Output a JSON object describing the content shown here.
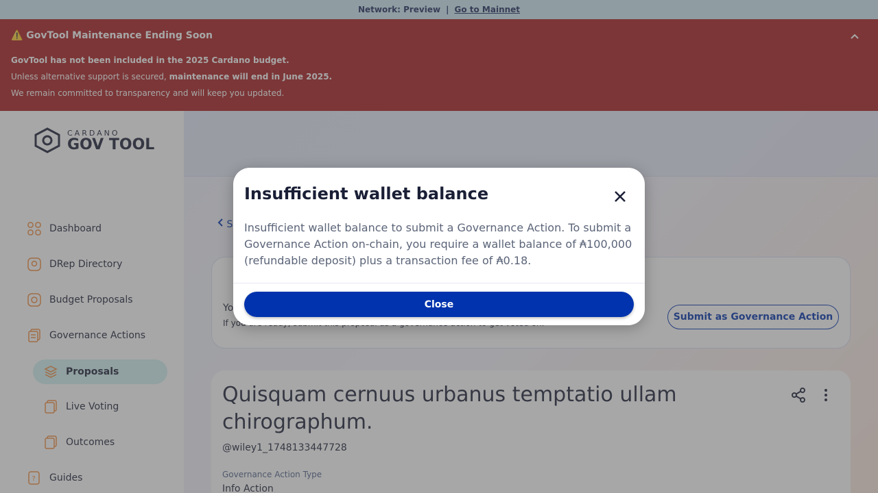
{
  "network_bar": {
    "label": "Network: Preview",
    "separator": "|",
    "link": "Go to Mainnet"
  },
  "banner": {
    "title": "⚠️ GovTool Maintenance Ending Soon",
    "line1": "GovTool has not been included in the 2025 Cardano budget.",
    "line2_prefix": "Unless alternative support is secured,",
    "line2_bold": "maintenance will end in June 2025.",
    "line3": "We remain committed to transparency and will keep you updated."
  },
  "logo": {
    "small": "CARDANO",
    "big": "GOV TOOL"
  },
  "sidebar": {
    "items": [
      {
        "label": "Dashboard",
        "icon": "dashboard-icon"
      },
      {
        "label": "DRep Directory",
        "icon": "drep-icon"
      },
      {
        "label": "Budget Proposals",
        "icon": "budget-icon"
      },
      {
        "label": "Governance Actions",
        "icon": "document-icon"
      },
      {
        "label": "Proposals",
        "icon": "layers-icon"
      },
      {
        "label": "Live Voting",
        "icon": "document-icon"
      },
      {
        "label": "Outcomes",
        "icon": "document-icon"
      },
      {
        "label": "Guides",
        "icon": "guide-icon"
      }
    ]
  },
  "main": {
    "back_label": "S",
    "card1": {
      "title_fragment": "Yo",
      "subtitle": "If you are ready, submit this proposal as a governance action to get voted on.",
      "submit_label": "Submit as Governance Action"
    },
    "card2": {
      "heading": "Quisquam cernuus urbanus temptatio ullam chirographum.",
      "username": "@wiley1_1748133447728",
      "type_label": "Governance Action Type",
      "type_value": "Info Action"
    }
  },
  "modal": {
    "title": "Insufficient wallet balance",
    "body": "Insufficient wallet balance to submit a Governance Action. To submit a Governance Action on-chain, you require a wallet balance of ₳100,000 (refundable deposit) plus a transaction fee of ₳0.18.",
    "button": "Close"
  },
  "colors": {
    "primary": "#0033ad",
    "banner": "#a81c1f",
    "network_bar": "#cfe9f5",
    "active_nav": "#d2f0f0"
  }
}
